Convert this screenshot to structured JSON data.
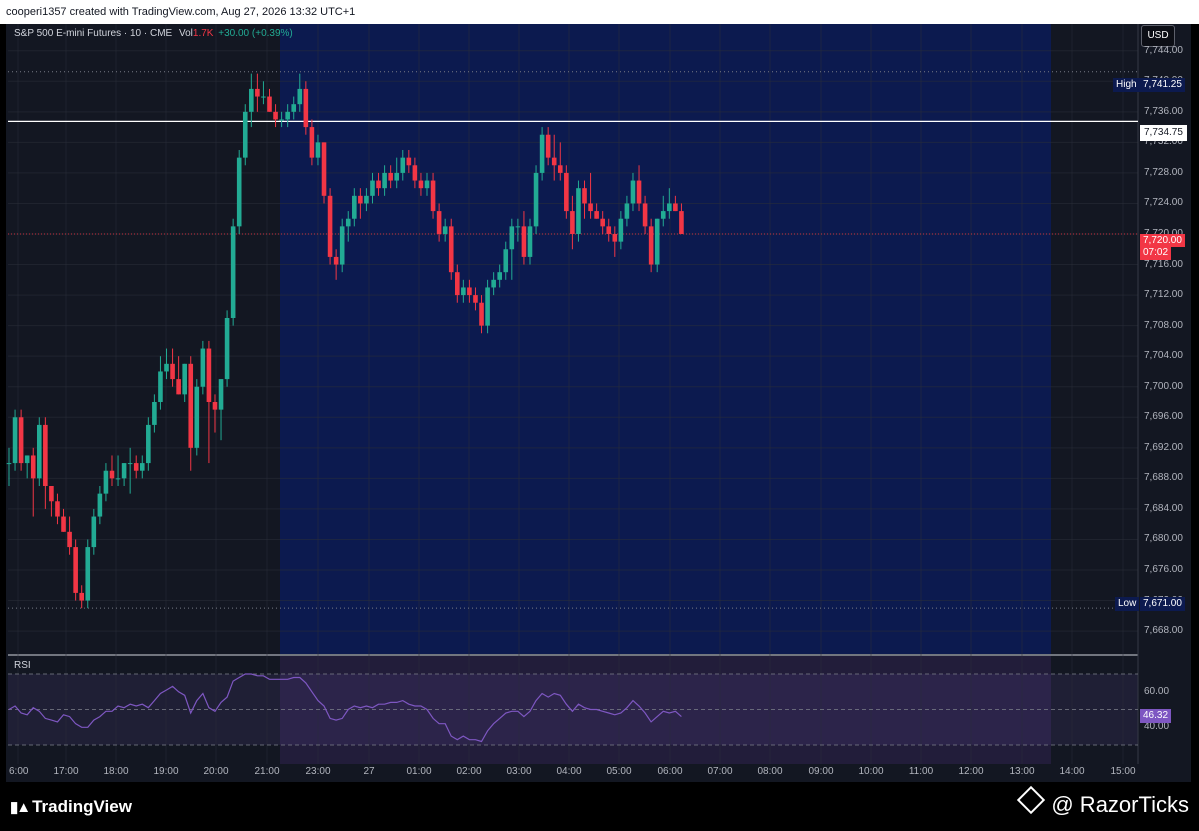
{
  "header": {
    "caption": "cooperi1357 created with TradingView.com, Aug 27, 2026 13:32 UTC+1"
  },
  "legend": {
    "symbol": "S&P 500 E-mini Futures · 10 · CME",
    "volume_label": "Vol",
    "volume_value": "1.7K",
    "change": "+30.00 (+0.39%)"
  },
  "currency_button": "USD",
  "colors": {
    "up": "#22ab94",
    "down": "#f23645",
    "session_background": "#0c1a4f",
    "rsi_line": "#7e57c2",
    "background": "#131722"
  },
  "labels": {
    "high_tag": "High",
    "high_value": "7,741.25",
    "low_tag": "Low",
    "low_value": "7,671.00",
    "level_value": "7,734.75",
    "last_price": "7,720.00",
    "countdown": "07:02",
    "rsi_title": "RSI",
    "rsi_value": "46.32"
  },
  "price_axis": [
    "7,744.00",
    "7,740.00",
    "7,736.00",
    "7,732.00",
    "7,728.00",
    "7,724.00",
    "7,720.00",
    "7,716.00",
    "7,712.00",
    "7,708.00",
    "7,704.00",
    "7,700.00",
    "7,696.00",
    "7,692.00",
    "7,688.00",
    "7,684.00",
    "7,680.00",
    "7,676.00",
    "7,672.00",
    "7,668.00"
  ],
  "rsi_axis": [
    "60.00",
    "40.00"
  ],
  "time_axis": [
    "6:00",
    "17:00",
    "18:00",
    "19:00",
    "20:00",
    "21:00",
    "23:00",
    "27",
    "01:00",
    "02:00",
    "03:00",
    "04:00",
    "05:00",
    "06:00",
    "07:00",
    "08:00",
    "09:00",
    "10:00",
    "11:00",
    "12:00",
    "13:00",
    "14:00",
    "15:00"
  ],
  "chart_data": {
    "type": "candlestick",
    "title": "S&P 500 E-mini Futures · 10 · CME",
    "interval": "10 minutes",
    "ylim": [
      7666,
      7747
    ],
    "grid": true,
    "horizontal_level": 7734.75,
    "session_high": 7741.25,
    "session_low": 7671.0,
    "last_price": 7720.0,
    "candles": [
      [
        7690,
        7692,
        7687,
        7690
      ],
      [
        7690,
        7697,
        7689,
        7696
      ],
      [
        7696,
        7697,
        7689,
        7690
      ],
      [
        7690,
        7691,
        7688,
        7691
      ],
      [
        7691,
        7692,
        7683,
        7688
      ],
      [
        7688,
        7696,
        7687,
        7695
      ],
      [
        7695,
        7696,
        7684,
        7687
      ],
      [
        7687,
        7687,
        7683,
        7685
      ],
      [
        7685,
        7686,
        7682,
        7683
      ],
      [
        7683,
        7684,
        7681,
        7681
      ],
      [
        7681,
        7683,
        7678,
        7679
      ],
      [
        7679,
        7680,
        7672,
        7673
      ],
      [
        7673,
        7674,
        7671,
        7672
      ],
      [
        7672,
        7680,
        7671,
        7679
      ],
      [
        7679,
        7684,
        7678,
        7683
      ],
      [
        7683,
        7687,
        7682,
        7686
      ],
      [
        7686,
        7690,
        7685,
        7689
      ],
      [
        7689,
        7691,
        7687,
        7688
      ],
      [
        7688,
        7691,
        7687,
        7688
      ],
      [
        7688,
        7690,
        7687,
        7690
      ],
      [
        7690,
        7692,
        7686,
        7690
      ],
      [
        7690,
        7691,
        7688,
        7689
      ],
      [
        7689,
        7691,
        7688,
        7690
      ],
      [
        7690,
        7696,
        7689,
        7695
      ],
      [
        7695,
        7699,
        7694,
        7698
      ],
      [
        7698,
        7704,
        7697,
        7702
      ],
      [
        7702,
        7705,
        7701,
        7703
      ],
      [
        7703,
        7705,
        7700,
        7701
      ],
      [
        7701,
        7704,
        7699,
        7699
      ],
      [
        7699,
        7703,
        7698,
        7703
      ],
      [
        7703,
        7704,
        7689,
        7692
      ],
      [
        7692,
        7701,
        7691,
        7700
      ],
      [
        7700,
        7706,
        7699,
        7705
      ],
      [
        7705,
        7706,
        7690,
        7698
      ],
      [
        7698,
        7699,
        7694,
        7697
      ],
      [
        7697,
        7700,
        7693,
        7701
      ],
      [
        7701,
        7710,
        7700,
        7709
      ],
      [
        7709,
        7722,
        7708,
        7721
      ],
      [
        7721,
        7731,
        7720,
        7730
      ],
      [
        7730,
        7737,
        7729,
        7736
      ],
      [
        7736,
        7741,
        7734,
        7739
      ],
      [
        7739,
        7741,
        7736,
        7738
      ],
      [
        7738,
        7740,
        7737,
        7738
      ],
      [
        7738,
        7739,
        7736,
        7736
      ],
      [
        7736,
        7737,
        7734,
        7735
      ],
      [
        7735,
        7736,
        7734,
        7735
      ],
      [
        7735,
        7737,
        7734,
        7736
      ],
      [
        7736,
        7738,
        7735,
        7737
      ],
      [
        7737,
        7741,
        7736,
        7739
      ],
      [
        7739,
        7740,
        7733,
        7734
      ],
      [
        7734,
        7735,
        7729,
        7730
      ],
      [
        7730,
        7733,
        7729,
        7732
      ],
      [
        7732,
        7732,
        7724,
        7725
      ],
      [
        7725,
        7726,
        7716,
        7717
      ],
      [
        7717,
        7718,
        7714,
        7716
      ],
      [
        7716,
        7722,
        7715,
        7721
      ],
      [
        7721,
        7723,
        7719,
        7722
      ],
      [
        7722,
        7726,
        7721,
        7725
      ],
      [
        7725,
        7726,
        7722,
        7724
      ],
      [
        7724,
        7726,
        7723,
        7725
      ],
      [
        7725,
        7728,
        7724,
        7727
      ],
      [
        7727,
        7728,
        7725,
        7726
      ],
      [
        7726,
        7729,
        7725,
        7728
      ],
      [
        7728,
        7729,
        7726,
        7727
      ],
      [
        7727,
        7730,
        7726,
        7728
      ],
      [
        7728,
        7731,
        7727,
        7730
      ],
      [
        7730,
        7731,
        7728,
        7729
      ],
      [
        7729,
        7730,
        7726,
        7727
      ],
      [
        7727,
        7728,
        7725,
        7726
      ],
      [
        7726,
        7728,
        7725,
        7727
      ],
      [
        7727,
        7728,
        7722,
        7723
      ],
      [
        7723,
        7724,
        7719,
        7720
      ],
      [
        7720,
        7722,
        7719,
        7721
      ],
      [
        7721,
        7722,
        7714,
        7715
      ],
      [
        7715,
        7716,
        7711,
        7712
      ],
      [
        7712,
        7714,
        7711,
        7713
      ],
      [
        7713,
        7714,
        7711,
        7712
      ],
      [
        7712,
        7713,
        7710,
        7711
      ],
      [
        7711,
        7712,
        7707,
        7708
      ],
      [
        7708,
        7714,
        7707,
        7713
      ],
      [
        7713,
        7715,
        7712,
        7714
      ],
      [
        7714,
        7716,
        7713,
        7715
      ],
      [
        7715,
        7719,
        7714,
        7718
      ],
      [
        7718,
        7722,
        7714,
        7721
      ],
      [
        7721,
        7722,
        7719,
        7721
      ],
      [
        7721,
        7723,
        7716,
        7717
      ],
      [
        7717,
        7722,
        7716,
        7721
      ],
      [
        7721,
        7729,
        7720,
        7728
      ],
      [
        7728,
        7734,
        7727,
        7733
      ],
      [
        7733,
        7734,
        7729,
        7730
      ],
      [
        7730,
        7733,
        7727,
        7729
      ],
      [
        7729,
        7732,
        7727,
        7728
      ],
      [
        7728,
        7729,
        7722,
        7723
      ],
      [
        7723,
        7725,
        7718,
        7720
      ],
      [
        7720,
        7727,
        7719,
        7726
      ],
      [
        7726,
        7727,
        7722,
        7724
      ],
      [
        7724,
        7728,
        7722,
        7723
      ],
      [
        7723,
        7724,
        7722,
        7722
      ],
      [
        7722,
        7723,
        7720,
        7721
      ],
      [
        7721,
        7722,
        7719,
        7720
      ],
      [
        7720,
        7721,
        7717,
        7719
      ],
      [
        7719,
        7723,
        7718,
        7722
      ],
      [
        7722,
        7725,
        7721,
        7724
      ],
      [
        7724,
        7728,
        7723,
        7727
      ],
      [
        7727,
        7729,
        7723,
        7724
      ],
      [
        7724,
        7725,
        7720,
        7721
      ],
      [
        7721,
        7722,
        7715,
        7716
      ],
      [
        7716,
        7722,
        7715,
        7722
      ],
      [
        7722,
        7725,
        7721,
        7723
      ],
      [
        7723,
        7726,
        7722,
        7724
      ],
      [
        7724,
        7725,
        7723,
        7723
      ],
      [
        7723,
        7724,
        7720,
        7720
      ]
    ],
    "rsi": {
      "name": "RSI",
      "last": 46.32,
      "levels": [
        70,
        50,
        30
      ],
      "values": [
        50,
        52,
        48,
        47,
        51,
        49,
        45,
        44,
        43,
        47,
        46,
        42,
        40,
        40,
        44,
        46,
        49,
        49,
        52,
        51,
        53,
        52,
        53,
        51,
        55,
        59,
        61,
        63,
        60,
        58,
        48,
        55,
        59,
        51,
        49,
        54,
        57,
        66,
        68,
        70,
        70,
        69,
        69,
        67,
        67,
        67,
        67,
        68,
        68,
        65,
        60,
        55,
        52,
        45,
        44,
        45,
        50,
        52,
        51,
        52,
        51,
        53,
        53,
        54,
        54,
        55,
        53,
        52,
        52,
        50,
        45,
        42,
        42,
        35,
        33,
        35,
        33,
        33,
        32,
        38,
        42,
        45,
        48,
        49,
        49,
        46,
        49,
        55,
        59,
        57,
        59,
        58,
        53,
        49,
        53,
        51,
        50,
        50,
        49,
        48,
        47,
        48,
        51,
        55,
        52,
        48,
        43,
        46,
        49,
        48,
        49,
        46
      ]
    },
    "xlabel": "",
    "ylabel": ""
  }
}
